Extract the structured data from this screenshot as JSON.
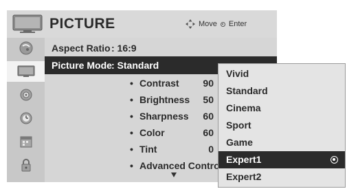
{
  "header": {
    "icon": "tv-monitor-icon",
    "title": "PICTURE",
    "hint_move": "Move",
    "hint_enter": "Enter"
  },
  "sidebar": {
    "items": [
      {
        "icon": "satellite-dish-icon"
      },
      {
        "icon": "tv-picture-icon",
        "active": true
      },
      {
        "icon": "speaker-audio-icon"
      },
      {
        "icon": "clock-time-icon"
      },
      {
        "icon": "calendar-option-icon"
      },
      {
        "icon": "lock-icon"
      }
    ]
  },
  "settings": {
    "aspect_ratio": {
      "label": "Aspect Ratio",
      "value": ": 16:9"
    },
    "picture_mode": {
      "label": "Picture Mode",
      "value": ": Standard"
    },
    "sub_items": [
      {
        "bullet": "•",
        "label": "Contrast",
        "value": "90"
      },
      {
        "bullet": "•",
        "label": "Brightness",
        "value": "50"
      },
      {
        "bullet": "•",
        "label": "Sharpness",
        "value": "60"
      },
      {
        "bullet": "•",
        "label": "Color",
        "value": "60"
      },
      {
        "bullet": "•",
        "label": "Tint",
        "value": "0"
      },
      {
        "bullet": "•",
        "label": "Advanced Contro",
        "value": ""
      }
    ]
  },
  "dropdown": {
    "options": [
      "Vivid",
      "Standard",
      "Cinema",
      "Sport",
      "Game",
      "Expert1",
      "Expert2"
    ],
    "selected": "Expert1"
  },
  "colors": {
    "panel": "#d6d6d6",
    "highlight": "#2b2b2b",
    "header": "#d9d9d9"
  }
}
